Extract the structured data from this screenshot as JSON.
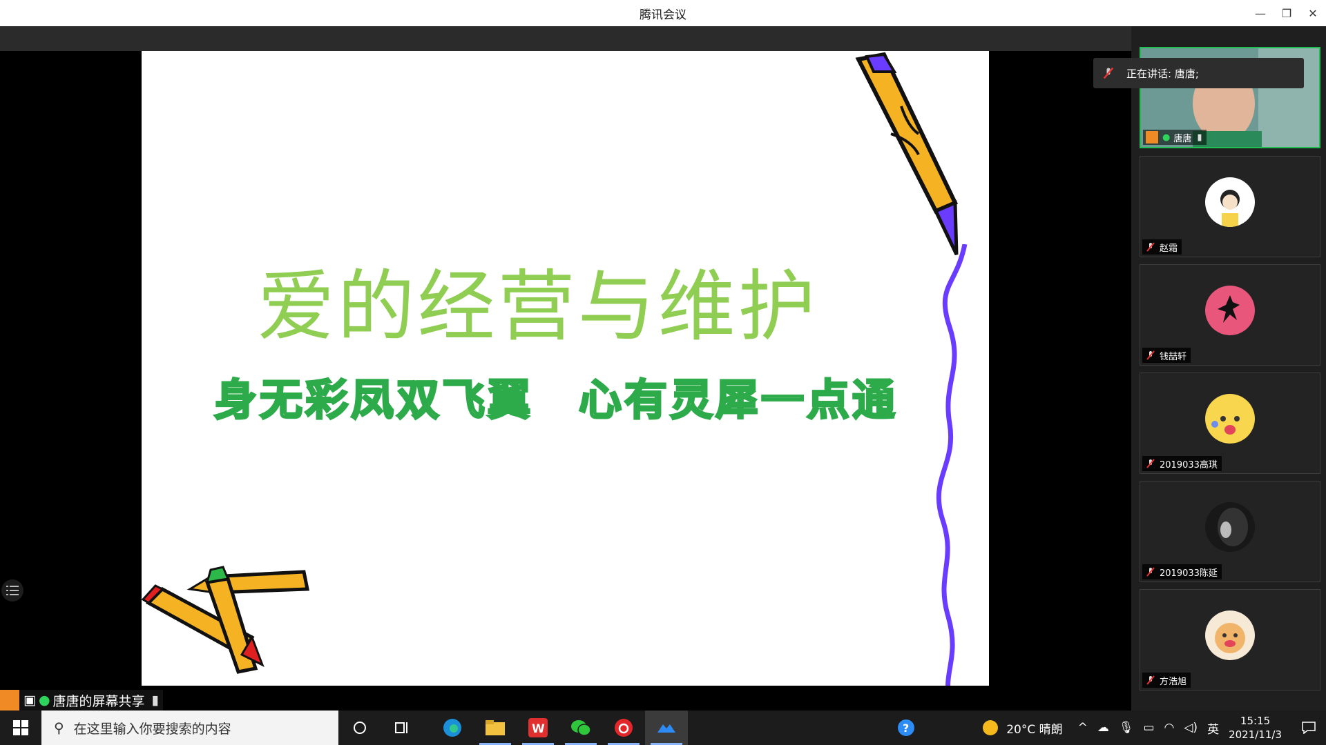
{
  "window": {
    "title": "腾讯会议",
    "controls": {
      "minimize": "—",
      "restore": "❐",
      "close": "✕"
    }
  },
  "slide": {
    "title": "爱的经营与维护",
    "subtitle": "身无彩凤双飞翼　心有灵犀一点通"
  },
  "speaker_popup": {
    "text": "正在讲话: 唐唐;"
  },
  "participants": [
    {
      "name": "唐唐",
      "muted": false,
      "speaking": true
    },
    {
      "name": "赵霜",
      "muted": true
    },
    {
      "name": "钱喆轩",
      "muted": true
    },
    {
      "name": "2019033高琪",
      "muted": true
    },
    {
      "name": "2019033陈延",
      "muted": true
    },
    {
      "name": "方浩旭",
      "muted": true
    }
  ],
  "share_bar": {
    "label": "唐唐的屏幕共享"
  },
  "taskbar": {
    "search_placeholder": "在这里输入你要搜索的内容",
    "weather": "20°C 晴朗",
    "ime": "英",
    "time": "15:15",
    "date": "2021/11/3"
  },
  "colors": {
    "accent_green": "#1fbf52",
    "title_green": "#8fce52",
    "sub_green": "#2dab4a"
  }
}
